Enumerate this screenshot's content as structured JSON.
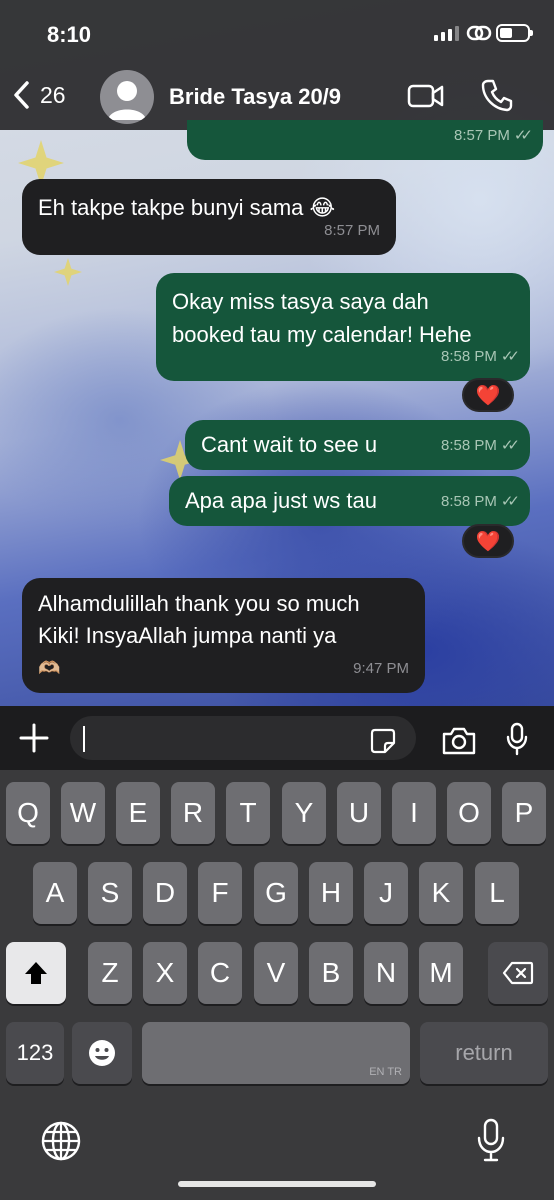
{
  "status_bar": {
    "time": "8:10"
  },
  "header": {
    "back_count": "26",
    "contact_name": "Bride Tasya 20/9"
  },
  "messages": [
    {
      "direction": "out",
      "text": "",
      "time": "8:57 PM",
      "status": "read"
    },
    {
      "direction": "in",
      "text": "Eh takpe takpe bunyi sama 😂",
      "time": "8:57 PM"
    },
    {
      "direction": "out",
      "line1": "Okay miss tasya saya dah",
      "line2": "booked tau my calendar! Hehe",
      "time": "8:58 PM",
      "status": "read",
      "reaction": "❤️"
    },
    {
      "direction": "out",
      "text": "Cant wait to see u",
      "time": "8:58 PM",
      "status": "read"
    },
    {
      "direction": "out",
      "text": "Apa apa just ws tau",
      "time": "8:58 PM",
      "status": "read",
      "reaction": "❤️"
    },
    {
      "direction": "in",
      "line1": "Alhamdulillah thank you so much",
      "line2": "Kiki! InsyaAllah jumpa nanti ya",
      "line3": "🫶🏼",
      "time": "9:47 PM"
    }
  ],
  "input": {
    "value": "",
    "placeholder": ""
  },
  "keyboard": {
    "row1": [
      "Q",
      "W",
      "E",
      "R",
      "T",
      "Y",
      "U",
      "I",
      "O",
      "P"
    ],
    "row2": [
      "A",
      "S",
      "D",
      "F",
      "G",
      "H",
      "J",
      "K",
      "L"
    ],
    "row3": [
      "Z",
      "X",
      "C",
      "V",
      "B",
      "N",
      "M"
    ],
    "numbers_label": "123",
    "space_sublabel": "EN TR",
    "return_label": "return"
  },
  "icons": [
    "back-chevron-icon",
    "avatar-icon",
    "video-call-icon",
    "phone-icon",
    "plus-icon",
    "sticker-icon",
    "camera-icon",
    "microphone-icon",
    "shift-icon",
    "delete-icon",
    "emoji-icon",
    "globe-icon",
    "dictation-icon"
  ],
  "colors": {
    "outgoing_bubble": "#15563b",
    "incoming_bubble": "#1f1f21",
    "keyboard_bg": "#3a3a3c"
  }
}
